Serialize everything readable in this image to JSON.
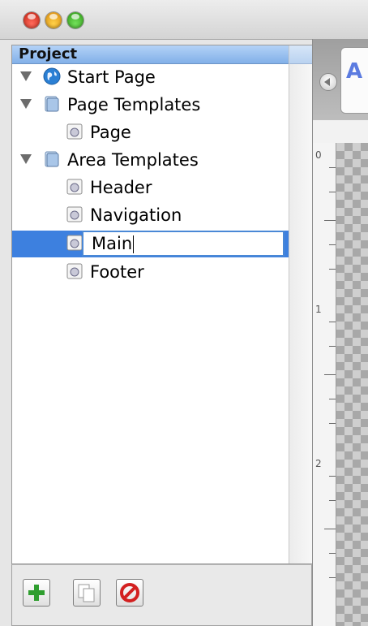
{
  "window": {
    "traffic_lights": [
      "close-button",
      "minimize-button",
      "zoom-button"
    ]
  },
  "outline": {
    "column_header": "Project",
    "items": [
      {
        "label": "Start Page",
        "icon": "globe-icon",
        "indent": 0,
        "disclosure": "expanded"
      },
      {
        "label": "Page Templates",
        "icon": "folder-icon",
        "indent": 0,
        "disclosure": "expanded"
      },
      {
        "label": "Page",
        "icon": "template-icon",
        "indent": 1,
        "disclosure": "none"
      },
      {
        "label": "Area Templates",
        "icon": "folder-icon",
        "indent": 0,
        "disclosure": "expanded"
      },
      {
        "label": "Header",
        "icon": "template-icon",
        "indent": 1,
        "disclosure": "none"
      },
      {
        "label": "Navigation",
        "icon": "template-icon",
        "indent": 1,
        "disclosure": "none"
      },
      {
        "label": "Main",
        "icon": "template-icon",
        "indent": 1,
        "disclosure": "none",
        "selected": true,
        "editing": true
      },
      {
        "label": "Footer",
        "icon": "template-icon",
        "indent": 1,
        "disclosure": "none"
      }
    ]
  },
  "toolbar": {
    "buttons": [
      {
        "name": "add-button",
        "icon": "plus-icon"
      },
      {
        "name": "duplicate-button",
        "icon": "duplicate-icon"
      },
      {
        "name": "delete-button",
        "icon": "prohibit-icon"
      }
    ]
  },
  "editor": {
    "tab_letter": "A",
    "ruler_labels": [
      "0",
      "1",
      "2"
    ]
  },
  "colors": {
    "selection": "#3d80df",
    "header": "#9fc3f0",
    "add": "#2f9e2f",
    "delete": "#d32020"
  }
}
